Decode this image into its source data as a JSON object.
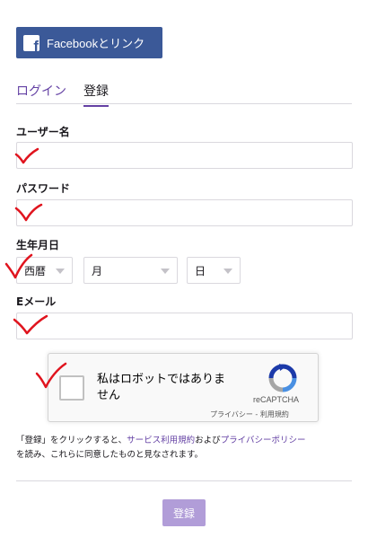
{
  "facebook": {
    "label": "Facebookとリンク",
    "logo_letter": "f",
    "color": "#3b5998"
  },
  "tabs": [
    {
      "label": "ログイン",
      "active": false
    },
    {
      "label": "登録",
      "active": true
    }
  ],
  "form": {
    "username_label": "ユーザー名",
    "password_label": "パスワード",
    "birthdate_label": "生年月日",
    "birthdate": {
      "era": "西暦",
      "month": "月",
      "day": "日"
    },
    "email_label": "Eメール"
  },
  "captcha": {
    "text": "私はロボットではありません",
    "brand": "reCAPTCHA",
    "privacy": "プライバシー",
    "separator": " - ",
    "terms": "利用規約"
  },
  "terms": {
    "part1": "「登録」をクリックすると、",
    "link1": "サービス利用規約",
    "part2": "および",
    "link2": "プライバシーポリシー",
    "part3": "を読み、これらに同意したものと見なされます。"
  },
  "submit_label": "登録",
  "colors": {
    "accent": "#6441a4",
    "submit": "#b19dd8",
    "annotation": "#e0141e"
  }
}
